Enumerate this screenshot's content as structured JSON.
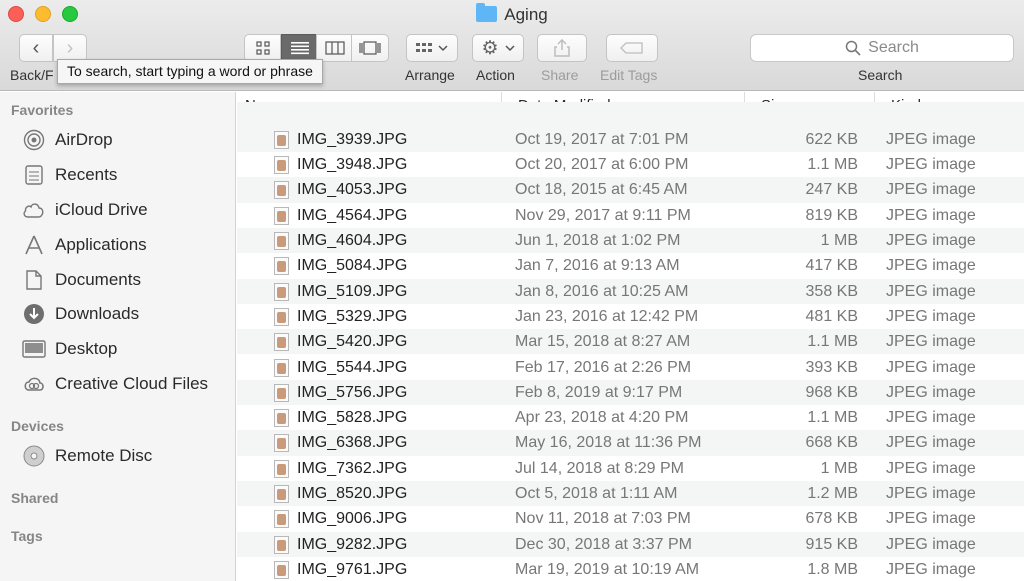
{
  "window": {
    "title": "Aging"
  },
  "toolbar": {
    "back_forward_label": "Back/F",
    "arrange_label": "Arrange",
    "action_label": "Action",
    "share_label": "Share",
    "edit_tags_label": "Edit Tags",
    "search_label": "Search",
    "search_placeholder": "Search"
  },
  "tooltip": "To search, start typing a word or phrase",
  "sidebar": {
    "favorites_header": "Favorites",
    "favorites": [
      {
        "label": "AirDrop",
        "icon": "airdrop-icon"
      },
      {
        "label": "Recents",
        "icon": "recents-icon"
      },
      {
        "label": "iCloud Drive",
        "icon": "cloud-icon"
      },
      {
        "label": "Applications",
        "icon": "applications-icon"
      },
      {
        "label": "Documents",
        "icon": "documents-icon"
      },
      {
        "label": "Downloads",
        "icon": "downloads-icon"
      },
      {
        "label": "Desktop",
        "icon": "desktop-icon"
      },
      {
        "label": "Creative Cloud Files",
        "icon": "creative-cloud-icon"
      }
    ],
    "devices_header": "Devices",
    "devices": [
      {
        "label": "Remote Disc",
        "icon": "disc-icon"
      }
    ],
    "shared_header": "Shared",
    "tags_header": "Tags"
  },
  "list": {
    "columns": [
      "Name",
      "Date Modified",
      "Size",
      "Kind"
    ],
    "rows": [
      {
        "name": "IMG_3939.JPG",
        "date": "Oct 19, 2017 at 7:01 PM",
        "size": "622 KB",
        "kind": "JPEG image"
      },
      {
        "name": "IMG_3948.JPG",
        "date": "Oct 20, 2017 at 6:00 PM",
        "size": "1.1 MB",
        "kind": "JPEG image"
      },
      {
        "name": "IMG_4053.JPG",
        "date": "Oct 18, 2015 at 6:45 AM",
        "size": "247 KB",
        "kind": "JPEG image"
      },
      {
        "name": "IMG_4564.JPG",
        "date": "Nov 29, 2017 at 9:11 PM",
        "size": "819 KB",
        "kind": "JPEG image"
      },
      {
        "name": "IMG_4604.JPG",
        "date": "Jun 1, 2018 at 1:02 PM",
        "size": "1 MB",
        "kind": "JPEG image"
      },
      {
        "name": "IMG_5084.JPG",
        "date": "Jan 7, 2016 at 9:13 AM",
        "size": "417 KB",
        "kind": "JPEG image"
      },
      {
        "name": "IMG_5109.JPG",
        "date": "Jan 8, 2016 at 10:25 AM",
        "size": "358 KB",
        "kind": "JPEG image"
      },
      {
        "name": "IMG_5329.JPG",
        "date": "Jan 23, 2016 at 12:42 PM",
        "size": "481 KB",
        "kind": "JPEG image"
      },
      {
        "name": "IMG_5420.JPG",
        "date": "Mar 15, 2018 at 8:27 AM",
        "size": "1.1 MB",
        "kind": "JPEG image"
      },
      {
        "name": "IMG_5544.JPG",
        "date": "Feb 17, 2016 at 2:26 PM",
        "size": "393 KB",
        "kind": "JPEG image"
      },
      {
        "name": "IMG_5756.JPG",
        "date": "Feb 8, 2019 at 9:17 PM",
        "size": "968 KB",
        "kind": "JPEG image"
      },
      {
        "name": "IMG_5828.JPG",
        "date": "Apr 23, 2018 at 4:20 PM",
        "size": "1.1 MB",
        "kind": "JPEG image"
      },
      {
        "name": "IMG_6368.JPG",
        "date": "May 16, 2018 at 11:36 PM",
        "size": "668 KB",
        "kind": "JPEG image"
      },
      {
        "name": "IMG_7362.JPG",
        "date": "Jul 14, 2018 at 8:29 PM",
        "size": "1 MB",
        "kind": "JPEG image"
      },
      {
        "name": "IMG_8520.JPG",
        "date": "Oct 5, 2018 at 1:11 AM",
        "size": "1.2 MB",
        "kind": "JPEG image"
      },
      {
        "name": "IMG_9006.JPG",
        "date": "Nov 11, 2018 at 7:03 PM",
        "size": "678 KB",
        "kind": "JPEG image"
      },
      {
        "name": "IMG_9282.JPG",
        "date": "Dec 30, 2018 at 3:37 PM",
        "size": "915 KB",
        "kind": "JPEG image"
      },
      {
        "name": "IMG_9761.JPG",
        "date": "Mar 19, 2019 at 10:19 AM",
        "size": "1.8 MB",
        "kind": "JPEG image"
      }
    ]
  },
  "colors": {
    "folder": "#5fb6f6",
    "close": "#fc5f57",
    "minimize": "#fdbc2e",
    "maximize": "#28c840",
    "active_view": "#6a6a6a"
  }
}
